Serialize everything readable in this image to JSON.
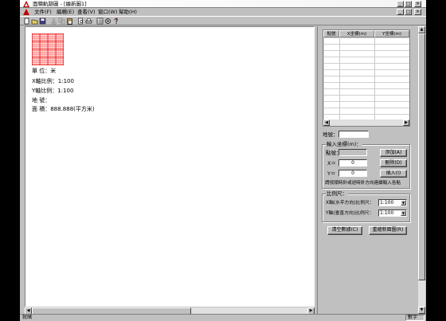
{
  "window": {
    "title": "面積軌跡圖 - [繪新圖1]",
    "minimize": "_",
    "maximize": "□",
    "close": "×"
  },
  "menu": {
    "items": [
      "文件(F)",
      "編輯(E)",
      "查看(V)",
      "窗口(W)",
      "幫助(H)"
    ]
  },
  "toolbar": {
    "icons": [
      "new-icon",
      "open-icon",
      "save-icon",
      "cut-icon",
      "copy-icon",
      "paste-icon",
      "print-preview-icon",
      "print-icon",
      "grid-icon",
      "target-icon",
      "help-icon"
    ]
  },
  "drawing": {
    "unit_line": "單    位：米",
    "x_scale_line": "X軸比例：1:100",
    "y_scale_line": "Y軸比例：1:100",
    "plot_line": "地    號：",
    "area_line": "面    積：888.888(平方米)"
  },
  "coord_table": {
    "headers": [
      "點號",
      "X坐標(m)",
      "Y坐標(m)"
    ]
  },
  "panel": {
    "plot_label": "地號：",
    "plot_value": "",
    "input_group_title": "輸入坐標(m)：",
    "point_label": "點號：",
    "point_value": "",
    "x_label": "X＝",
    "x_value": "0",
    "y_label": "Y＝",
    "y_value": "0",
    "add_button": "添加(A)",
    "delete_button": "刪除(D)",
    "insert_button": "插入(I)",
    "hint": "請按順時針或逆時針方向連續輸入各點",
    "scale_group_title": "比例尺：",
    "x_scale_label": "X軸(水平方向)比例尺：",
    "x_scale_value": "1:100",
    "y_scale_label": "Y軸(垂直方向)比例尺：",
    "y_scale_value": "1:100",
    "clear_button": "清空數據(C)",
    "redraw_button": "重繪新面圖(R)"
  },
  "status": {
    "text": "就緒",
    "pane": "數字"
  }
}
